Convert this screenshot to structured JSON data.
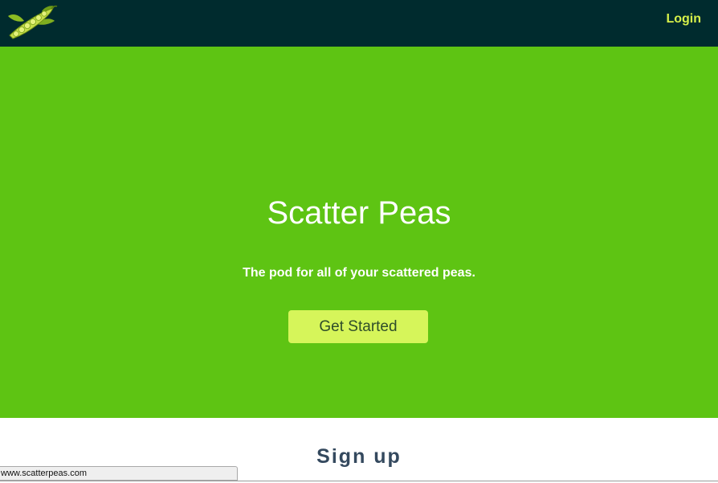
{
  "header": {
    "logo_icon": "pea-pod-icon",
    "login_label": "Login"
  },
  "hero": {
    "title": "Scatter Peas",
    "tagline": "The pod for all of your scattered peas.",
    "cta_label": "Get Started"
  },
  "signup": {
    "title": "Sign up"
  },
  "status_bar": {
    "url": "www.scatterpeas.com"
  },
  "colors": {
    "header_bg": "#002b2e",
    "hero_bg": "#5ec413",
    "accent": "#d6f04a",
    "cta_bg": "#d6f55a"
  }
}
